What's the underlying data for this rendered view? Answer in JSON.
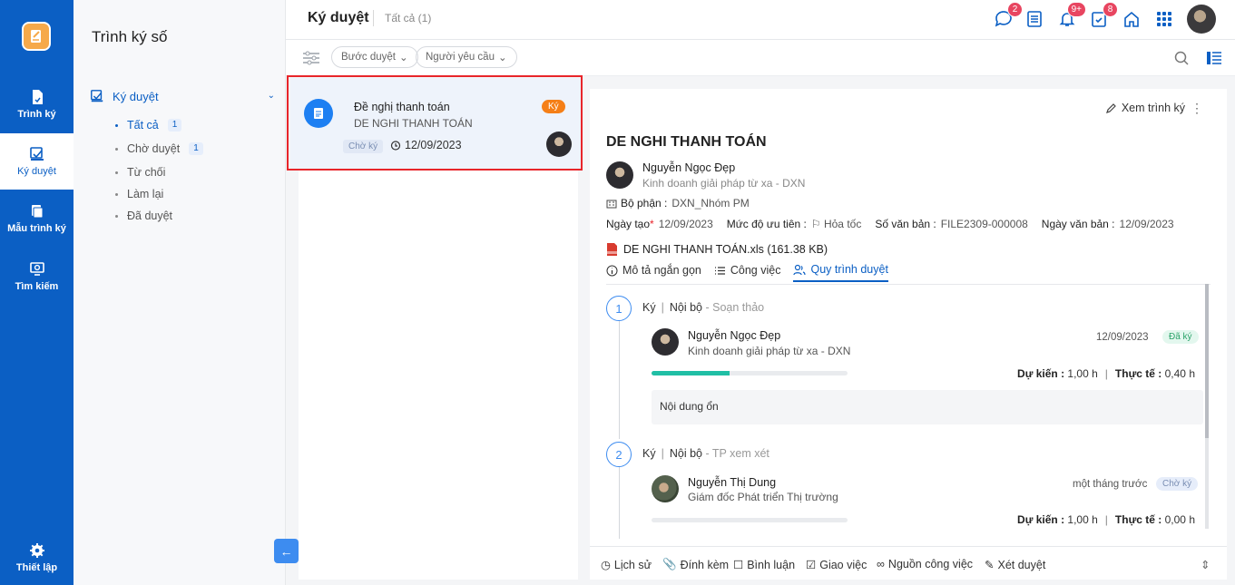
{
  "rail": {
    "items": [
      {
        "label": "Trình ký"
      },
      {
        "label": "Ký duyệt"
      },
      {
        "label": "Mẫu trình ký"
      },
      {
        "label": "Tìm kiếm"
      }
    ],
    "settings_label": "Thiết lập"
  },
  "sidebar": {
    "title": "Trình ký số",
    "group_label": "Ký duyệt",
    "sub_items": [
      {
        "label": "Tất cả",
        "count": "1"
      },
      {
        "label": "Chờ duyệt",
        "count": "1"
      },
      {
        "label": "Từ chối"
      },
      {
        "label": "Làm lại"
      },
      {
        "label": "Đã duyệt"
      }
    ]
  },
  "header": {
    "title": "Ký duyệt",
    "subtitle": "Tất cả (1)",
    "badges": {
      "chat": "2",
      "notifications": "9+",
      "tasks": "8"
    }
  },
  "filters": {
    "step": "Bước duyệt",
    "requester": "Người yêu cầu"
  },
  "card": {
    "title": "Đề nghị thanh toán",
    "subtitle": "DE NGHI THANH TOÁN",
    "tag": "Chờ ký",
    "date": "12/09/2023",
    "badge": "Ký"
  },
  "detail": {
    "view_label": "Xem trình ký",
    "title": "DE NGHI THANH TOÁN",
    "author_name": "Nguyễn Ngọc Đẹp",
    "author_dept": "Kinh doanh giải pháp từ xa - DXN",
    "dept_label": "Bộ phận :",
    "dept_value": "DXN_Nhóm PM",
    "created_label": "Ngày tạo",
    "created_value": "12/09/2023",
    "priority_label": "Mức độ ưu tiên :",
    "priority_value": "Hỏa tốc",
    "docno_label": "Số văn bản :",
    "docno_value": "FILE2309-000008",
    "docdate_label": "Ngày văn bản :",
    "docdate_value": "12/09/2023",
    "file_name": "DE NGHI THANH TOÁN.xls (161.38 KB)",
    "tabs": [
      "Mô tả ngắn gọn",
      "Công việc",
      "Quy trình duyệt"
    ]
  },
  "steps": [
    {
      "num": "1",
      "type": "Ký",
      "scope": "Nội bộ",
      "role": "Soạn thảo",
      "person": "Nguyễn Ngọc Đẹp",
      "dept": "Kinh doanh giải pháp từ xa - DXN",
      "date": "12/09/2023",
      "state": "Đã ký",
      "progress": 0.4,
      "planned_label": "Dự kiến :",
      "planned": "1,00 h",
      "actual_label": "Thực tế :",
      "actual": "0,40 h",
      "note": "Nội dung ổn"
    },
    {
      "num": "2",
      "type": "Ký",
      "scope": "Nội bộ",
      "role": "TP xem xét",
      "person": "Nguyễn Thị Dung",
      "dept": "Giám đốc Phát triển Thị trường",
      "date": "một tháng trước",
      "state": "Chờ ký",
      "progress": 0,
      "planned_label": "Dự kiến :",
      "planned": "1,00 h",
      "actual_label": "Thực tế :",
      "actual": "0,00 h"
    }
  ],
  "bottom": [
    "Lịch sử",
    "Đính kèm",
    "Bình luận",
    "Giao việc",
    "Nguồn công việc",
    "Xét duyệt"
  ],
  "colors": {
    "primary": "#0b5fc4",
    "accent": "#f57f17",
    "highlight": "#e8252a",
    "progress": "#20bfa5"
  }
}
